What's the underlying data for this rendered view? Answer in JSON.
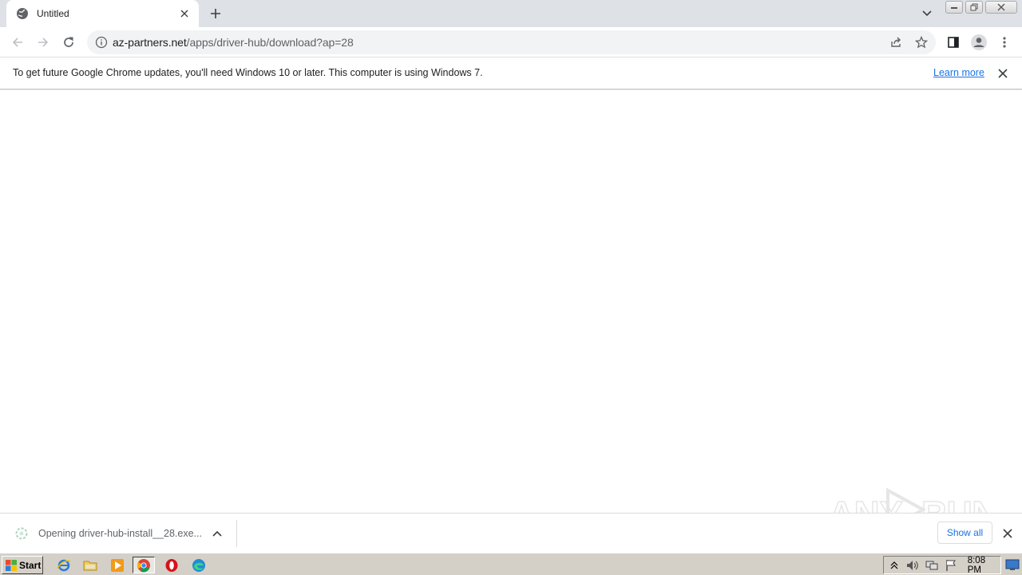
{
  "browser": {
    "tab": {
      "title": "Untitled"
    },
    "url": {
      "host": "az-partners.net",
      "path": "/apps/driver-hub/download?ap=28"
    }
  },
  "infobar": {
    "message": "To get future Google Chrome updates, you'll need Windows 10 or later. This computer is using Windows 7.",
    "link": "Learn more"
  },
  "download_shelf": {
    "item": "Opening driver-hub-install__28.exe...",
    "show_all": "Show all"
  },
  "watermark": {
    "text": "ANY RUN"
  },
  "taskbar": {
    "start": "Start",
    "clock": "8:08 PM"
  },
  "colors": {
    "accent": "#1a73e8",
    "tabstrip": "#dee1e6",
    "taskbar": "#d4d0c8"
  }
}
